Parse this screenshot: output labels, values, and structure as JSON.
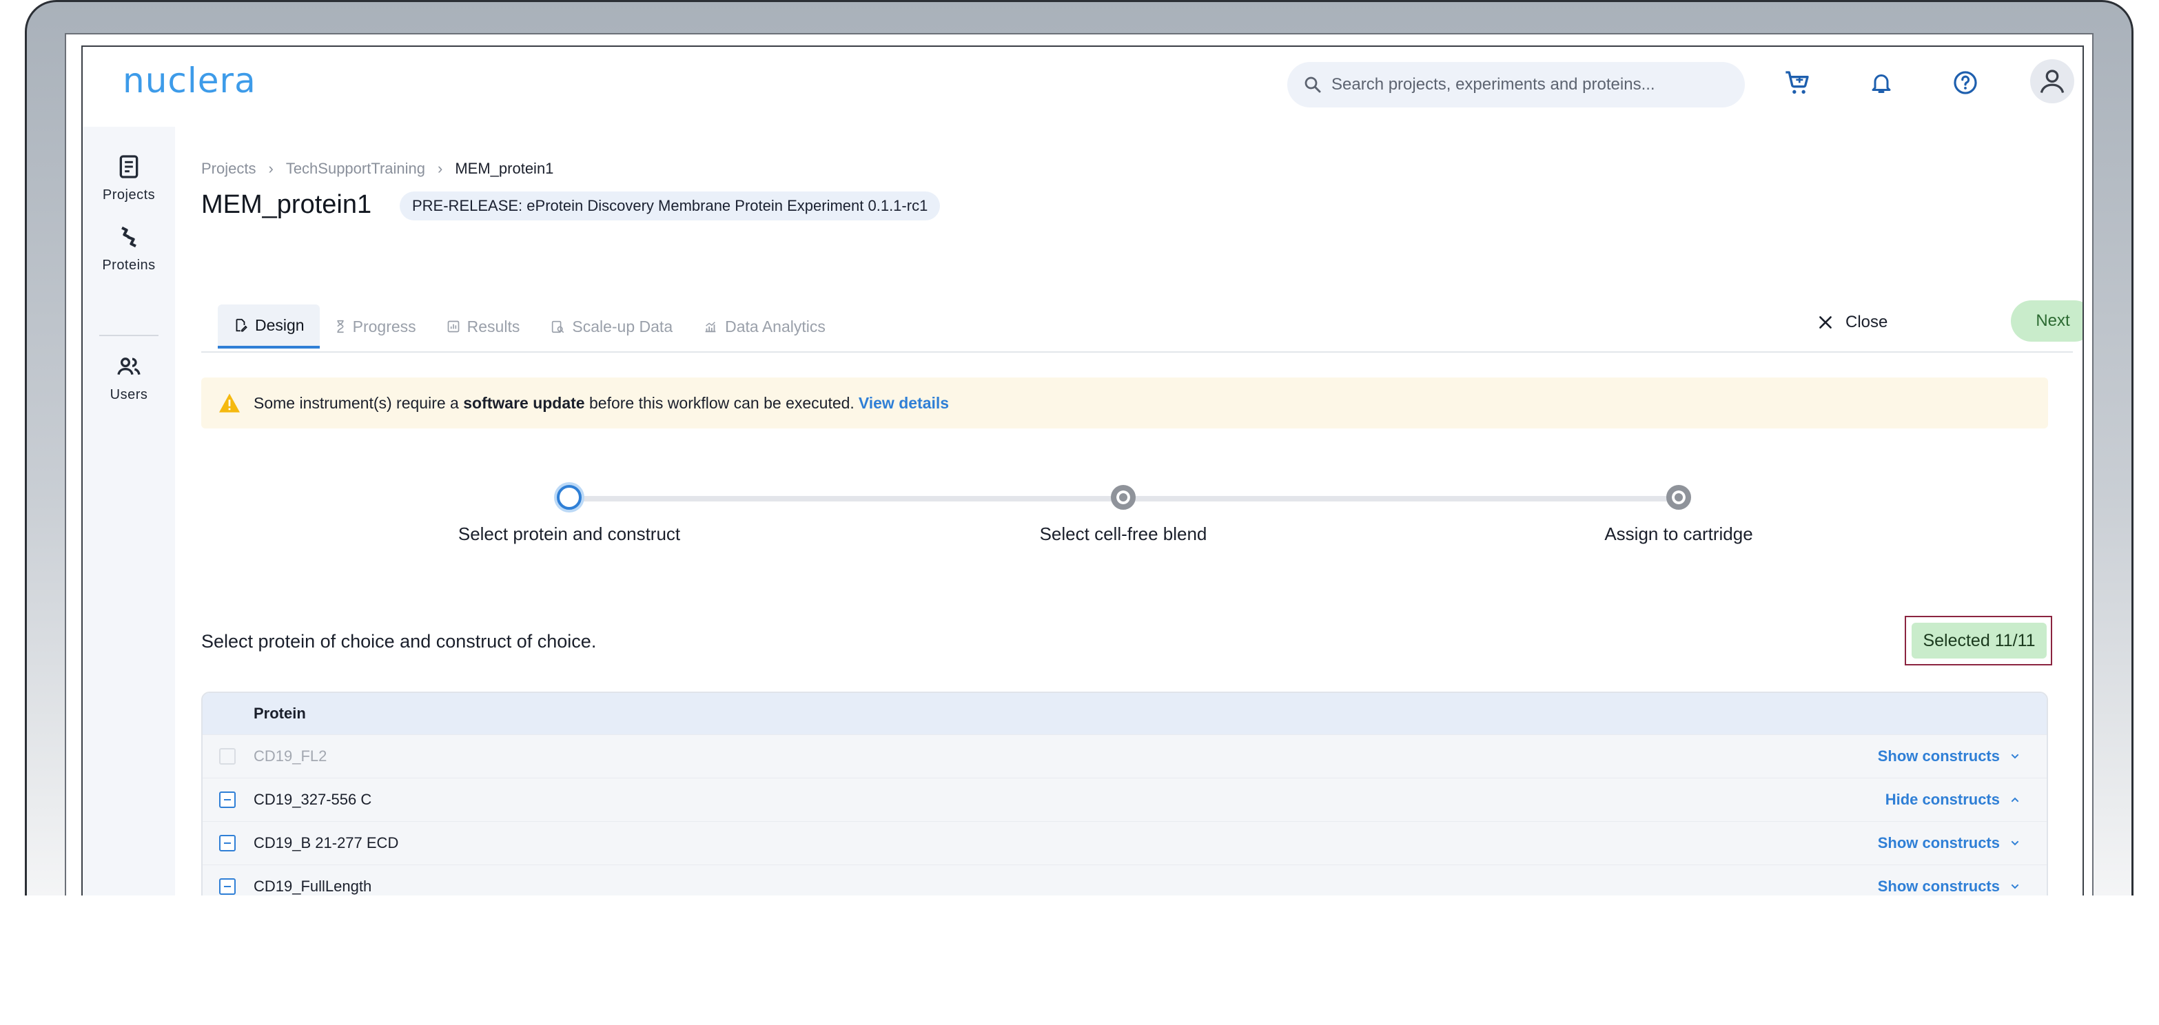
{
  "app": {
    "logo": "nuclera",
    "search_placeholder": "Search projects, experiments and proteins..."
  },
  "sidenav": {
    "items": [
      {
        "label": "Projects"
      },
      {
        "label": "Proteins"
      },
      {
        "label": "Users"
      }
    ]
  },
  "breadcrumb": [
    "Projects",
    "TechSupportTraining",
    "MEM_protein1"
  ],
  "breadcrumb_sep": "›",
  "page": {
    "title": "MEM_protein1",
    "tag": "PRE-RELEASE: eProtein Discovery Membrane Protein Experiment 0.1.1-rc1"
  },
  "tabs": [
    {
      "label": "Design",
      "active": true
    },
    {
      "label": "Progress"
    },
    {
      "label": "Results"
    },
    {
      "label": "Scale-up Data"
    },
    {
      "label": "Data Analytics"
    }
  ],
  "actions": {
    "close": "Close",
    "next": "Next"
  },
  "alert": {
    "pre": "Some instrument(s) require a",
    "bold": "software update",
    "post": "before this workflow can be executed.",
    "link": "View details"
  },
  "stepper": [
    {
      "label": "Select protein and construct",
      "state": "current"
    },
    {
      "label": "Select cell-free blend",
      "state": "pending"
    },
    {
      "label": "Assign to cartridge",
      "state": "pending"
    }
  ],
  "instruction": "Select protein of choice and construct of choice.",
  "selected": "Selected 11/11",
  "table": {
    "header": "Protein",
    "rows": [
      {
        "name": "CD19_FL2",
        "checked": false,
        "toggle": "Show constructs"
      },
      {
        "name": "CD19_327-556 C",
        "checked": true,
        "toggle": "Hide constructs"
      },
      {
        "name": "CD19_B 21-277 ECD",
        "checked": true,
        "toggle": "Show constructs"
      },
      {
        "name": "CD19_FullLength",
        "checked": true,
        "toggle": "Show constructs"
      }
    ]
  },
  "colors": {
    "brand": "#3d9be9",
    "accent": "#2f7fd6",
    "success_bg": "#c9eccb",
    "warning": "#f5b90f"
  }
}
